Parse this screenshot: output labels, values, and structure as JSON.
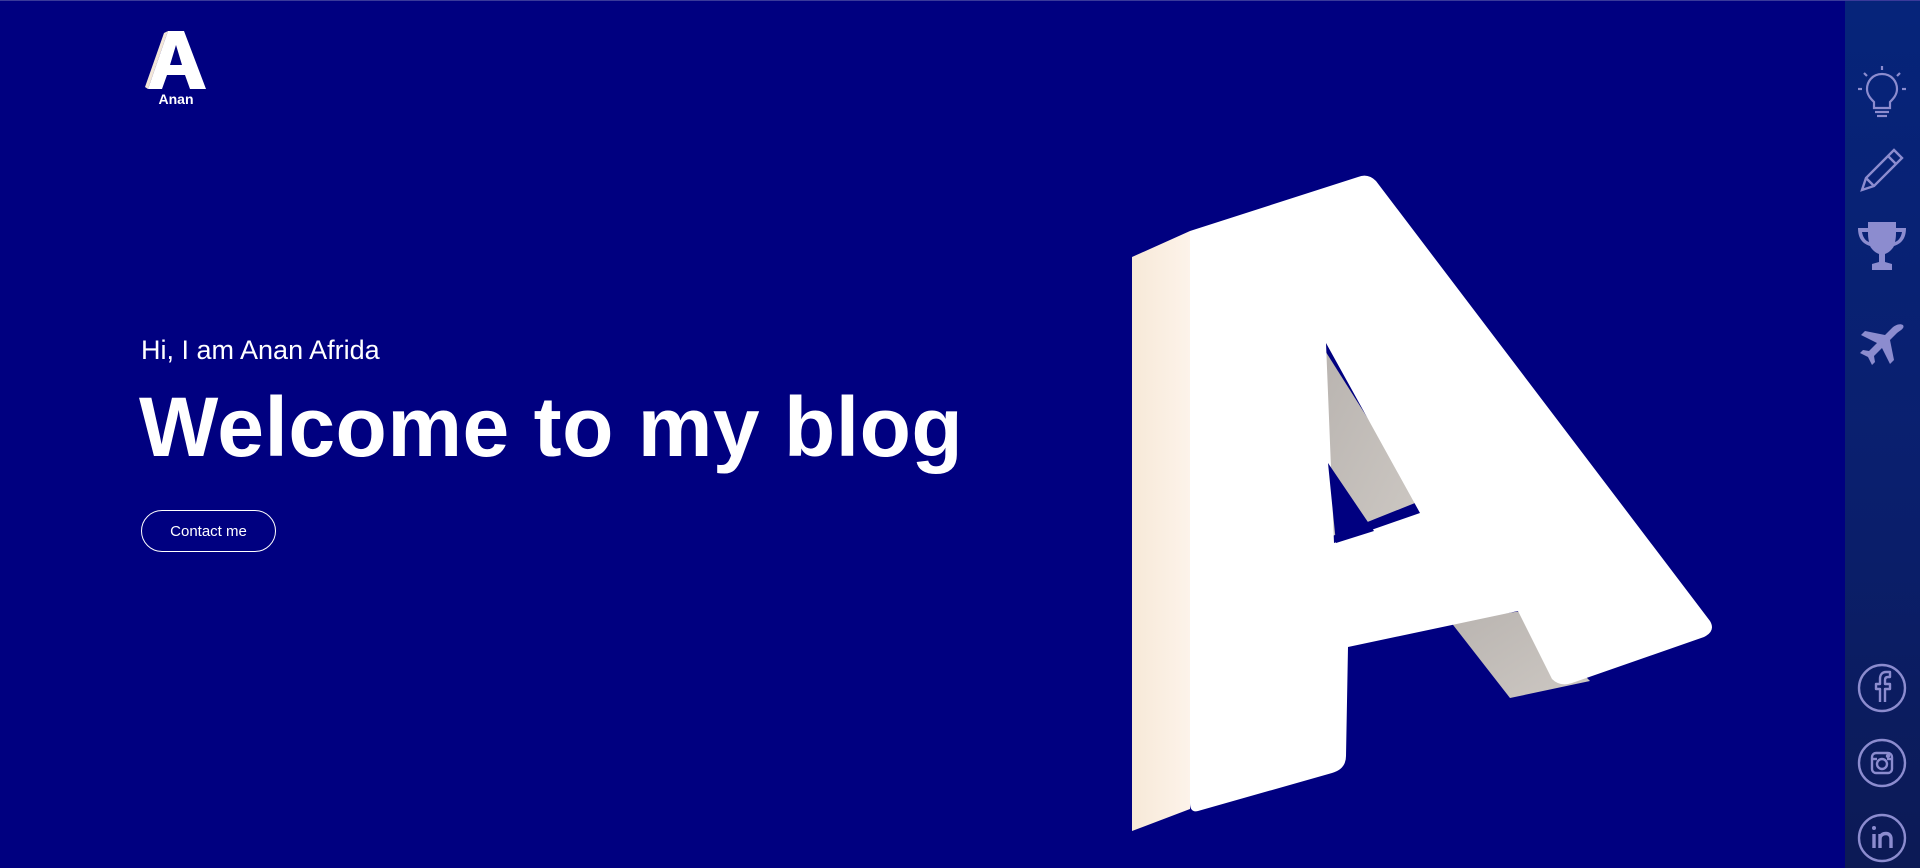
{
  "logo": {
    "letter": "A",
    "name": "Anan"
  },
  "hero": {
    "greeting": "Hi, I am Anan Afrida",
    "headline": "Welcome to my blog",
    "contact_label": "Contact me",
    "graphic_letter": "A"
  },
  "sidebar": {
    "nav_icons": [
      "lightbulb-icon",
      "pencil-icon",
      "trophy-icon",
      "airplane-icon"
    ],
    "social_icons": [
      "facebook-icon",
      "instagram-icon",
      "linkedin-icon"
    ]
  },
  "colors": {
    "background": "#000080",
    "sidebar": "#0a1f6e",
    "icon": "#8c8ccf",
    "text": "#ffffff"
  }
}
